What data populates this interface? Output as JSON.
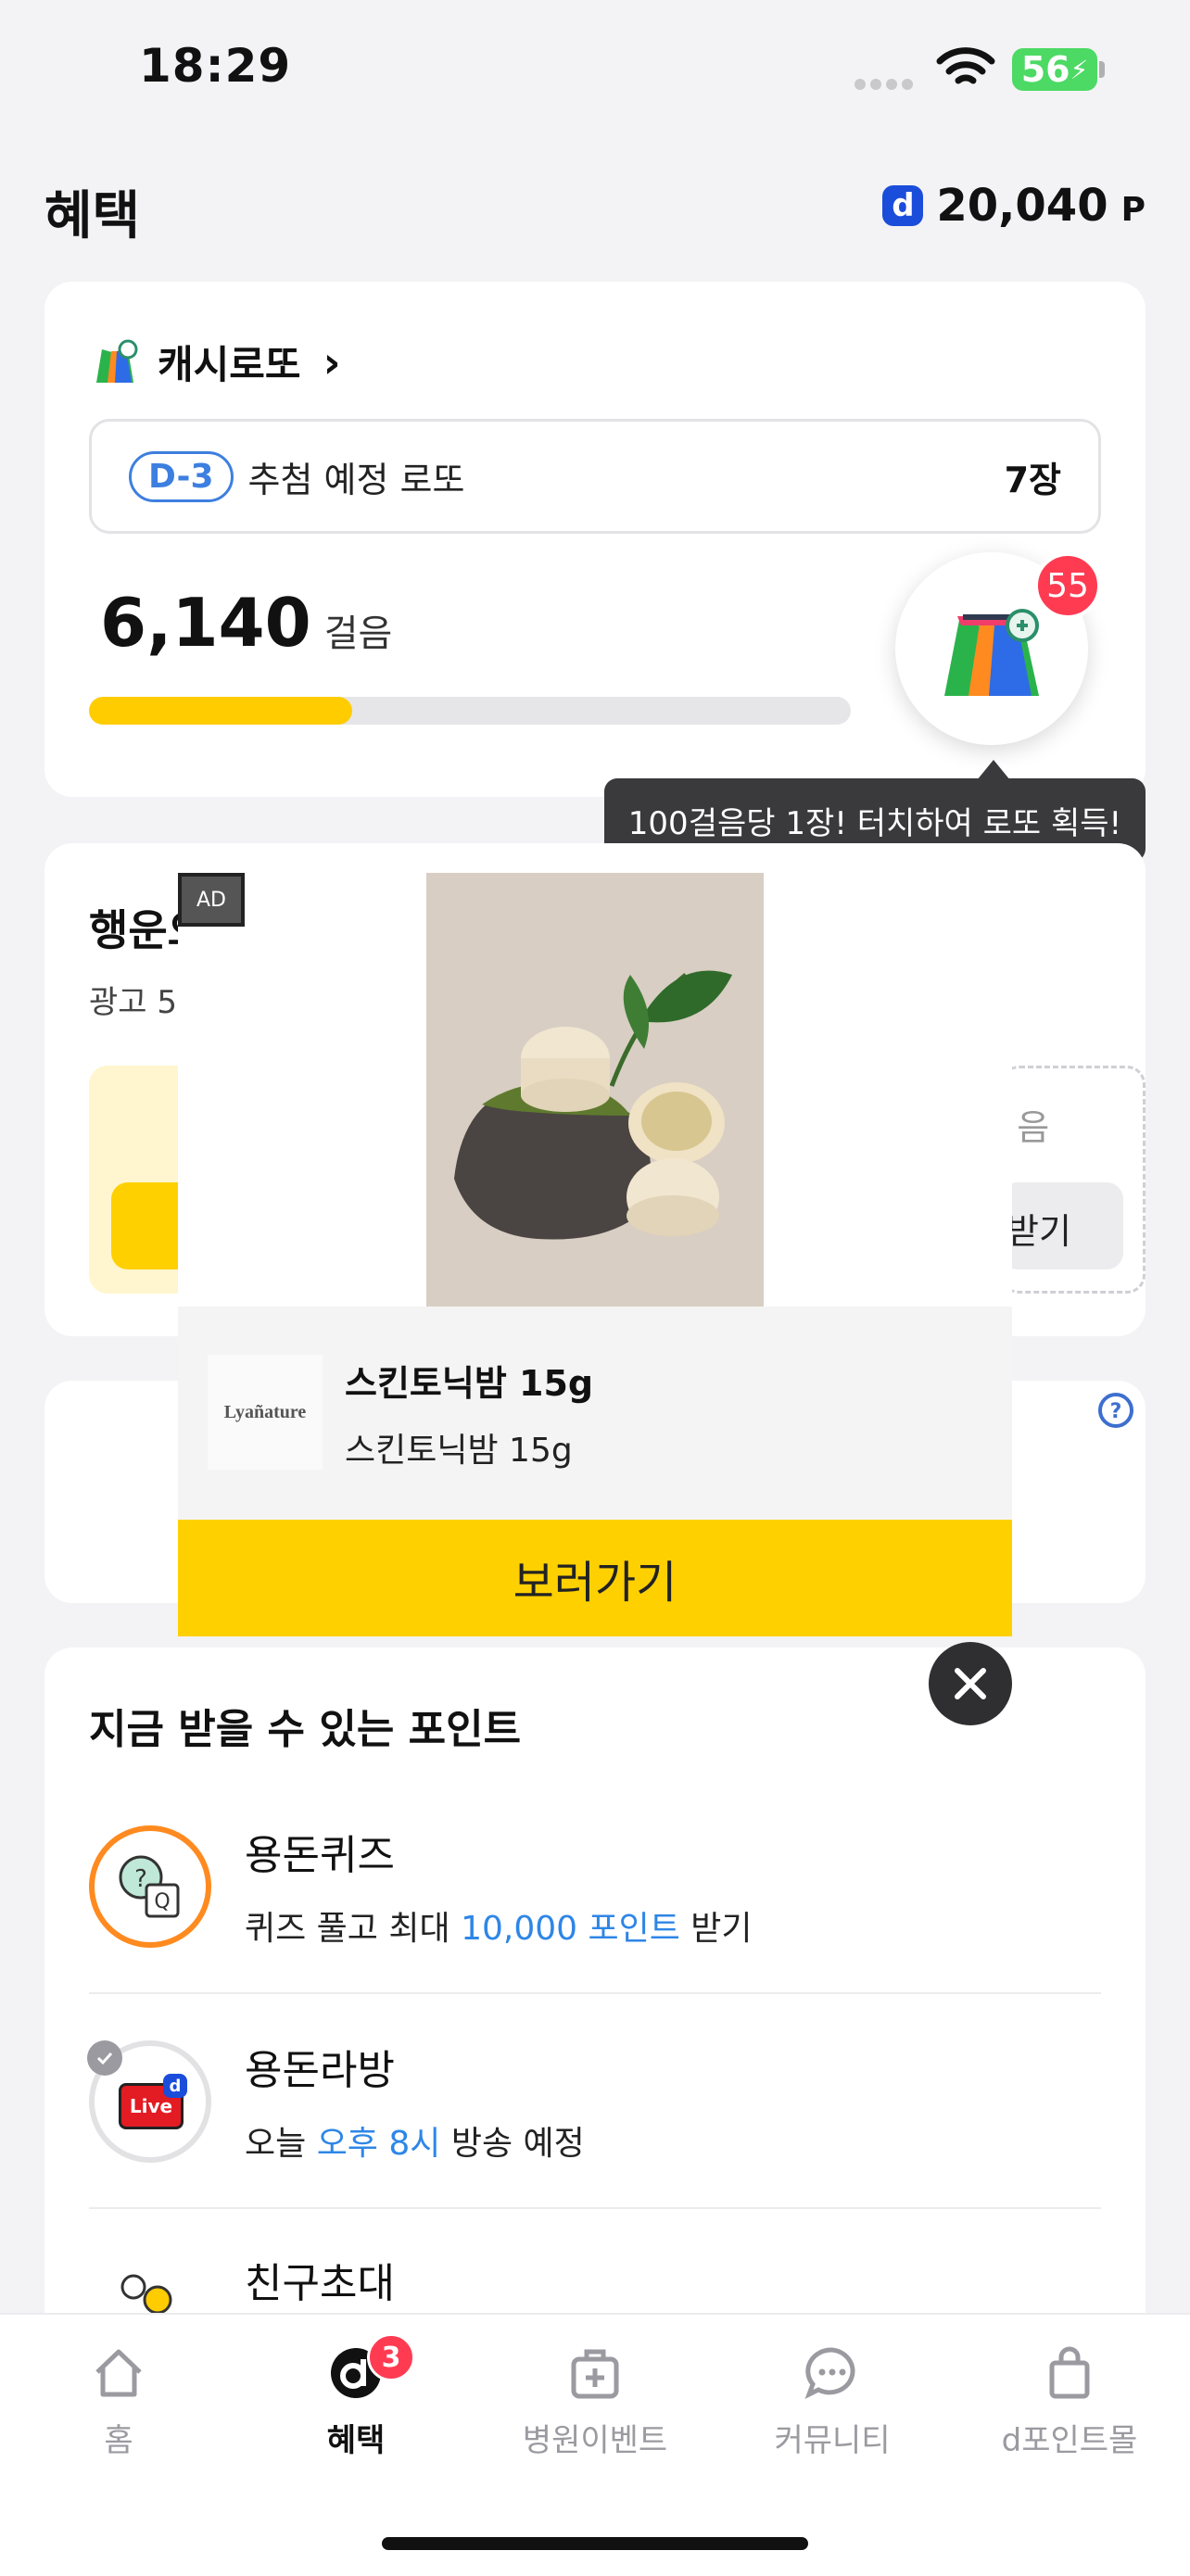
{
  "status": {
    "time": "18:29",
    "battery": "56"
  },
  "header": {
    "title": "혜택",
    "points": "20,040",
    "points_unit": "P",
    "logo_letter": "d"
  },
  "lotto": {
    "title": "캐시로또",
    "dday": "D-3",
    "scheduled_label": "추첨 예정 로또",
    "ticket_count": "7장",
    "steps": "6,140",
    "steps_unit": "걸음",
    "progress_fraction": 0.345,
    "bubble_badge": "55",
    "tooltip": "100걸음당 1장! 터치하여 로또 획득!"
  },
  "lucky": {
    "title_partial": "행운으",
    "sub_partial": "광고 5",
    "right_partial": "!음",
    "right_btn_partial": "받기"
  },
  "ad": {
    "tag": "AD",
    "brand": "Lyañature",
    "title": "스킨토닉밤 15g",
    "desc": "스킨토닉밤 15g",
    "cta": "보러가기"
  },
  "points_section": {
    "title": "지금 받을 수 있는 포인트",
    "items": [
      {
        "title": "용돈퀴즈",
        "pre": "퀴즈 풀고 최대 ",
        "hl": "10,000 포인트",
        "post": " 받기"
      },
      {
        "title": "용돈라방",
        "pre": "오늘 ",
        "hl": "오후 8시",
        "post": " 방송 예정",
        "live": "Live"
      },
      {
        "title": "친구초대"
      }
    ]
  },
  "tabs": [
    {
      "label": "홈"
    },
    {
      "label": "혜택",
      "badge": "3"
    },
    {
      "label": "병원이벤트"
    },
    {
      "label": "커뮤니티"
    },
    {
      "label": "d포인트몰"
    }
  ]
}
